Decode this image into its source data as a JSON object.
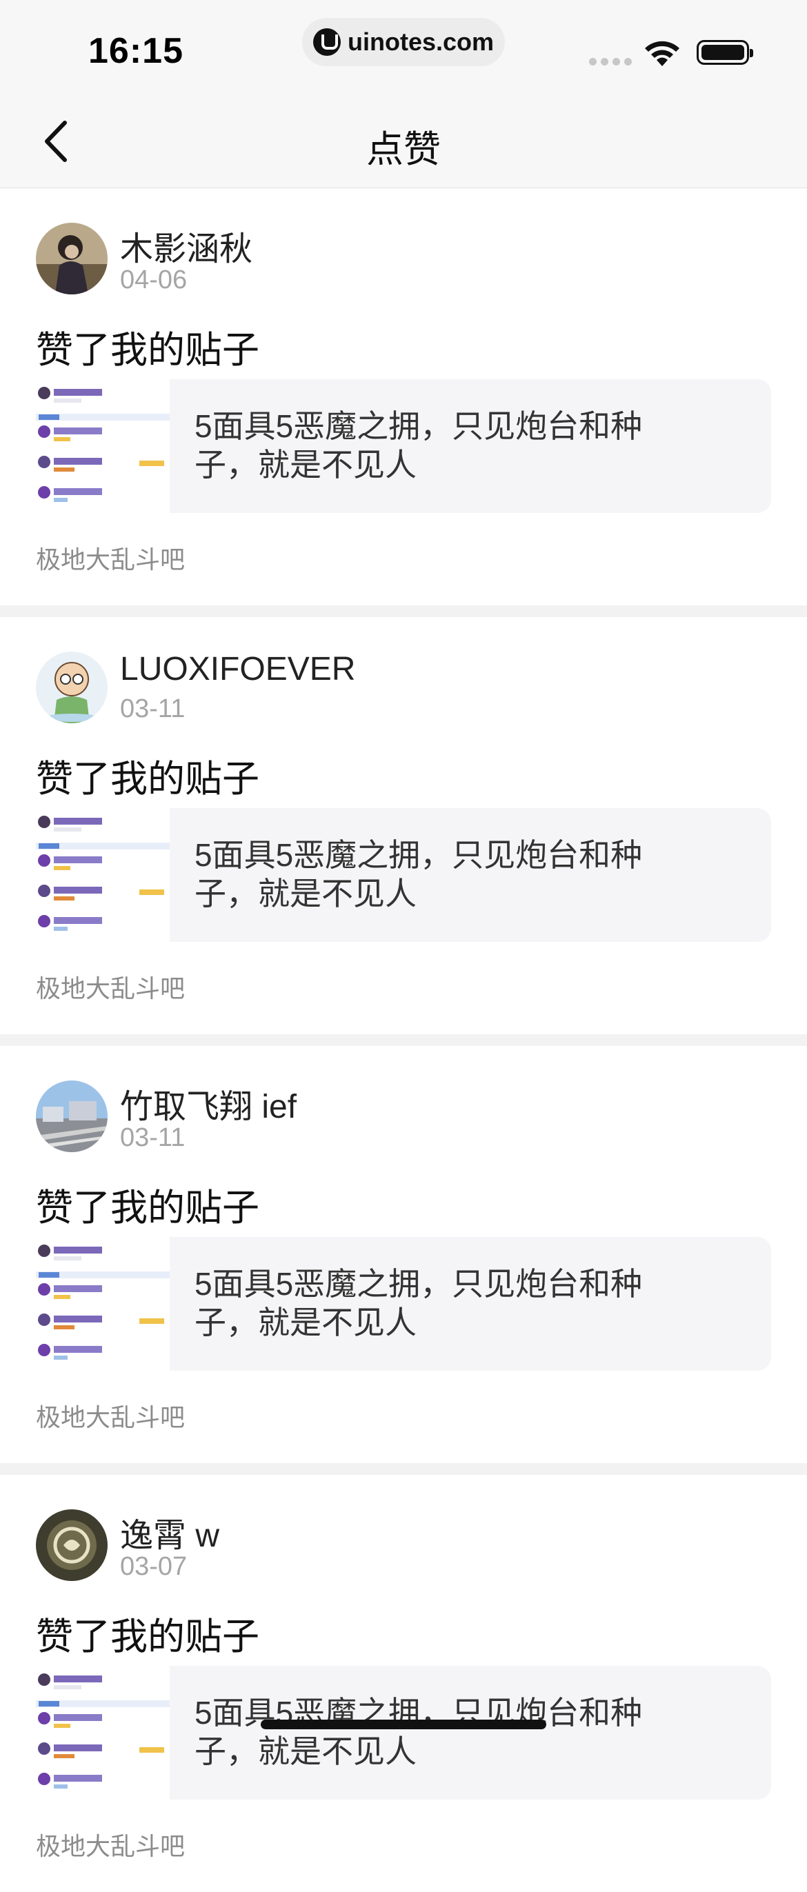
{
  "status_bar": {
    "time": "16:15",
    "url": "uinotes.com"
  },
  "nav": {
    "title": "点赞",
    "back_icon": "chevron-left-icon"
  },
  "items": [
    {
      "user": "木影涵秋",
      "date": "04-06",
      "action": "赞了我的贴子",
      "post_text": "5面具5恶魔之拥，只见炮台和种子，就是不见人",
      "forum": "极地大乱斗吧"
    },
    {
      "user": "LUOXIFOEVER",
      "date": "03-11",
      "action": "赞了我的贴子",
      "post_text": "5面具5恶魔之拥，只见炮台和种子，就是不见人",
      "forum": "极地大乱斗吧"
    },
    {
      "user": "竹取飞翔 ief",
      "date": "03-11",
      "action": "赞了我的贴子",
      "post_text": "5面具5恶魔之拥，只见炮台和种子，就是不见人",
      "forum": "极地大乱斗吧"
    },
    {
      "user": "逸霄 w",
      "date": "03-07",
      "action": "赞了我的贴子",
      "post_text": "5面具5恶魔之拥，只见炮台和种子，就是不见人",
      "forum": "极地大乱斗吧"
    }
  ],
  "colors": {
    "background": "#ffffff",
    "separator": "#f2f2f2",
    "post_box": "#f5f5f7",
    "muted_text": "#a5a5a5"
  }
}
